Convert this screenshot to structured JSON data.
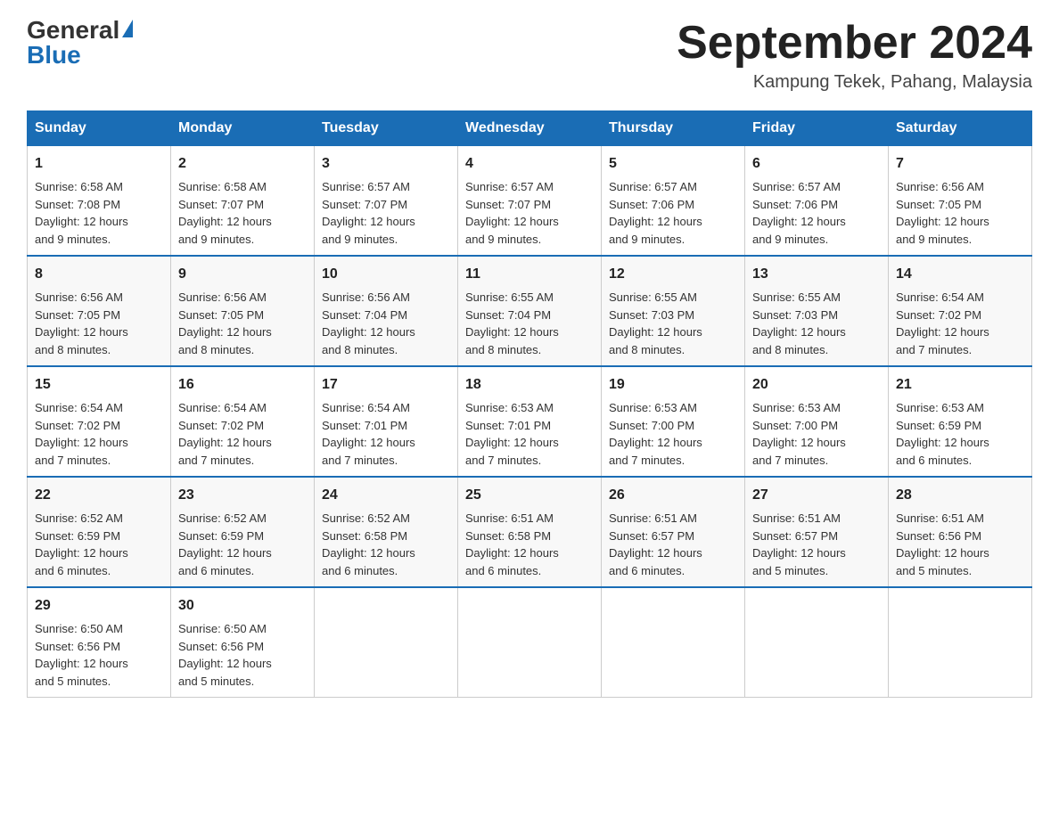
{
  "header": {
    "logo_general": "General",
    "logo_blue": "Blue",
    "month_title": "September 2024",
    "location": "Kampung Tekek, Pahang, Malaysia"
  },
  "weekdays": [
    "Sunday",
    "Monday",
    "Tuesday",
    "Wednesday",
    "Thursday",
    "Friday",
    "Saturday"
  ],
  "weeks": [
    [
      {
        "day": "1",
        "sunrise": "6:58 AM",
        "sunset": "7:08 PM",
        "daylight": "12 hours and 9 minutes."
      },
      {
        "day": "2",
        "sunrise": "6:58 AM",
        "sunset": "7:07 PM",
        "daylight": "12 hours and 9 minutes."
      },
      {
        "day": "3",
        "sunrise": "6:57 AM",
        "sunset": "7:07 PM",
        "daylight": "12 hours and 9 minutes."
      },
      {
        "day": "4",
        "sunrise": "6:57 AM",
        "sunset": "7:07 PM",
        "daylight": "12 hours and 9 minutes."
      },
      {
        "day": "5",
        "sunrise": "6:57 AM",
        "sunset": "7:06 PM",
        "daylight": "12 hours and 9 minutes."
      },
      {
        "day": "6",
        "sunrise": "6:57 AM",
        "sunset": "7:06 PM",
        "daylight": "12 hours and 9 minutes."
      },
      {
        "day": "7",
        "sunrise": "6:56 AM",
        "sunset": "7:05 PM",
        "daylight": "12 hours and 9 minutes."
      }
    ],
    [
      {
        "day": "8",
        "sunrise": "6:56 AM",
        "sunset": "7:05 PM",
        "daylight": "12 hours and 8 minutes."
      },
      {
        "day": "9",
        "sunrise": "6:56 AM",
        "sunset": "7:05 PM",
        "daylight": "12 hours and 8 minutes."
      },
      {
        "day": "10",
        "sunrise": "6:56 AM",
        "sunset": "7:04 PM",
        "daylight": "12 hours and 8 minutes."
      },
      {
        "day": "11",
        "sunrise": "6:55 AM",
        "sunset": "7:04 PM",
        "daylight": "12 hours and 8 minutes."
      },
      {
        "day": "12",
        "sunrise": "6:55 AM",
        "sunset": "7:03 PM",
        "daylight": "12 hours and 8 minutes."
      },
      {
        "day": "13",
        "sunrise": "6:55 AM",
        "sunset": "7:03 PM",
        "daylight": "12 hours and 8 minutes."
      },
      {
        "day": "14",
        "sunrise": "6:54 AM",
        "sunset": "7:02 PM",
        "daylight": "12 hours and 7 minutes."
      }
    ],
    [
      {
        "day": "15",
        "sunrise": "6:54 AM",
        "sunset": "7:02 PM",
        "daylight": "12 hours and 7 minutes."
      },
      {
        "day": "16",
        "sunrise": "6:54 AM",
        "sunset": "7:02 PM",
        "daylight": "12 hours and 7 minutes."
      },
      {
        "day": "17",
        "sunrise": "6:54 AM",
        "sunset": "7:01 PM",
        "daylight": "12 hours and 7 minutes."
      },
      {
        "day": "18",
        "sunrise": "6:53 AM",
        "sunset": "7:01 PM",
        "daylight": "12 hours and 7 minutes."
      },
      {
        "day": "19",
        "sunrise": "6:53 AM",
        "sunset": "7:00 PM",
        "daylight": "12 hours and 7 minutes."
      },
      {
        "day": "20",
        "sunrise": "6:53 AM",
        "sunset": "7:00 PM",
        "daylight": "12 hours and 7 minutes."
      },
      {
        "day": "21",
        "sunrise": "6:53 AM",
        "sunset": "6:59 PM",
        "daylight": "12 hours and 6 minutes."
      }
    ],
    [
      {
        "day": "22",
        "sunrise": "6:52 AM",
        "sunset": "6:59 PM",
        "daylight": "12 hours and 6 minutes."
      },
      {
        "day": "23",
        "sunrise": "6:52 AM",
        "sunset": "6:59 PM",
        "daylight": "12 hours and 6 minutes."
      },
      {
        "day": "24",
        "sunrise": "6:52 AM",
        "sunset": "6:58 PM",
        "daylight": "12 hours and 6 minutes."
      },
      {
        "day": "25",
        "sunrise": "6:51 AM",
        "sunset": "6:58 PM",
        "daylight": "12 hours and 6 minutes."
      },
      {
        "day": "26",
        "sunrise": "6:51 AM",
        "sunset": "6:57 PM",
        "daylight": "12 hours and 6 minutes."
      },
      {
        "day": "27",
        "sunrise": "6:51 AM",
        "sunset": "6:57 PM",
        "daylight": "12 hours and 5 minutes."
      },
      {
        "day": "28",
        "sunrise": "6:51 AM",
        "sunset": "6:56 PM",
        "daylight": "12 hours and 5 minutes."
      }
    ],
    [
      {
        "day": "29",
        "sunrise": "6:50 AM",
        "sunset": "6:56 PM",
        "daylight": "12 hours and 5 minutes."
      },
      {
        "day": "30",
        "sunrise": "6:50 AM",
        "sunset": "6:56 PM",
        "daylight": "12 hours and 5 minutes."
      },
      null,
      null,
      null,
      null,
      null
    ]
  ],
  "labels": {
    "sunrise": "Sunrise:",
    "sunset": "Sunset:",
    "daylight": "Daylight:"
  }
}
